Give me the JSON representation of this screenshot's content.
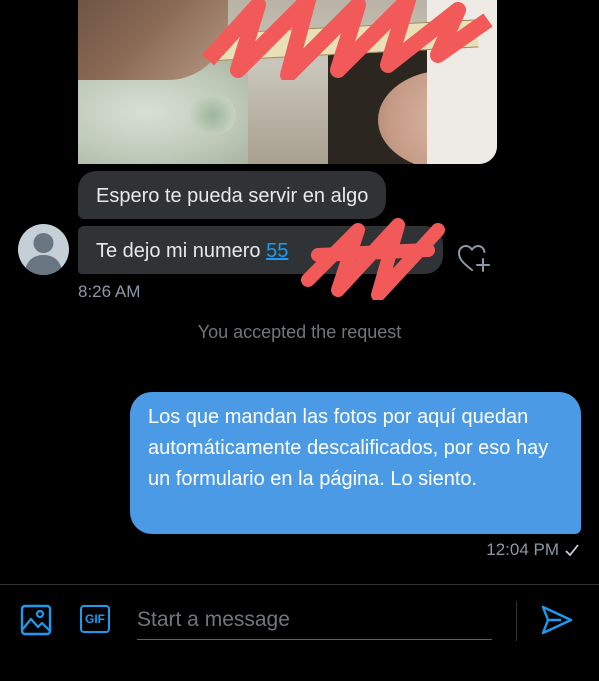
{
  "conversation": {
    "incoming": [
      {
        "text": "Espero te pueda servir en algo"
      },
      {
        "prefix": "Te dejo mi numero ",
        "link": "55"
      }
    ],
    "incoming_time": "8:26 AM",
    "system_message": "You accepted the request",
    "outgoing": {
      "text": "Los que mandan las fotos por aquí quedan automáticamente descalificados, por eso hay un formulario en la página. Lo siento.",
      "time": "12:04 PM"
    }
  },
  "composer": {
    "placeholder": "Start a message",
    "gif_label": "GIF"
  },
  "colors": {
    "accent": "#1d9bf0",
    "outgoing_bubble": "#4b9ae5",
    "incoming_bubble": "#2f3336",
    "redaction": "#f25a5a"
  },
  "icons": [
    "image-icon",
    "gif-icon",
    "send-icon",
    "add-reaction-icon",
    "read-check-icon"
  ]
}
